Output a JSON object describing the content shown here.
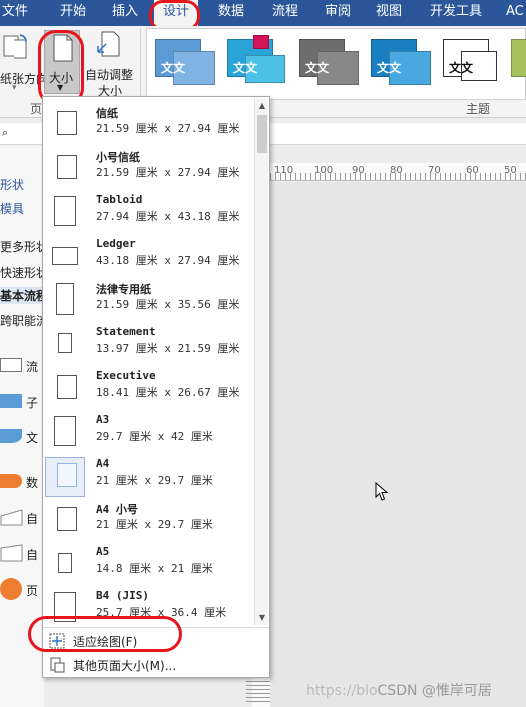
{
  "tabs": [
    "文件",
    "开始",
    "插入",
    "设计",
    "数据",
    "流程",
    "审阅",
    "视图",
    "开发工具",
    "AC"
  ],
  "ribbon": {
    "orientation_label": "纸张方向",
    "size_label": "大小",
    "autosize_label": "自动调整",
    "autosize_label2": "大小",
    "page_group": "页",
    "themes_group": "主题",
    "theme_text": "文文"
  },
  "ruler": {
    "labels": [
      "110",
      "100",
      "90",
      "80",
      "70",
      "60",
      "50"
    ]
  },
  "shapes_panel": {
    "labels": [
      "形状",
      "模具",
      "更多形状",
      "快速形状",
      "基本流程",
      "跨职能流"
    ],
    "shape_labels": [
      "流",
      "子",
      "文",
      "数",
      "自",
      "自",
      "页"
    ]
  },
  "dropdown": {
    "items": [
      {
        "name": "信纸",
        "dims": "21.59 厘米 x 27.94 厘米",
        "icon": "portrait-small-icon"
      },
      {
        "name": "小号信纸",
        "dims": "21.59 厘米 x 27.94 厘米",
        "icon": "portrait-small-icon"
      },
      {
        "name": "Tabloid",
        "dims": "27.94 厘米 x 43.18 厘米",
        "icon": "portrait-large-icon"
      },
      {
        "name": "Ledger",
        "dims": "43.18 厘米 x 27.94 厘米",
        "icon": "landscape-icon"
      },
      {
        "name": "法律专用纸",
        "dims": "21.59 厘米 x 35.56 厘米",
        "icon": "portrait-tall-icon"
      },
      {
        "name": "Statement",
        "dims": "13.97 厘米 x 21.59 厘米",
        "icon": "portrait-tiny-icon"
      },
      {
        "name": "Executive",
        "dims": "18.41 厘米 x 26.67 厘米",
        "icon": "portrait-small-icon"
      },
      {
        "name": "A3",
        "dims": "29.7 厘米 x 42 厘米",
        "icon": "portrait-large-icon"
      },
      {
        "name": "A4",
        "dims": "21 厘米 x 29.7 厘米",
        "icon": "portrait-small-icon"
      },
      {
        "name": "A4 小号",
        "dims": "21 厘米 x 29.7 厘米",
        "icon": "portrait-small-icon"
      },
      {
        "name": "A5",
        "dims": "14.8 厘米 x 21 厘米",
        "icon": "portrait-tiny-icon"
      },
      {
        "name": "B4 (JIS)",
        "dims": "25.7 厘米 x 36.4 厘米",
        "icon": "portrait-large-icon"
      }
    ],
    "selected": "A4",
    "fit_to_drawing": "适应绘图(F)",
    "more_sizes": "其他页面大小(M)..."
  },
  "watermark": {
    "prefix": "https://blo",
    "brand": "CSDN @惟岸可居"
  },
  "colors": {
    "accent": "#2b579a",
    "annotation": "#e8141c"
  }
}
